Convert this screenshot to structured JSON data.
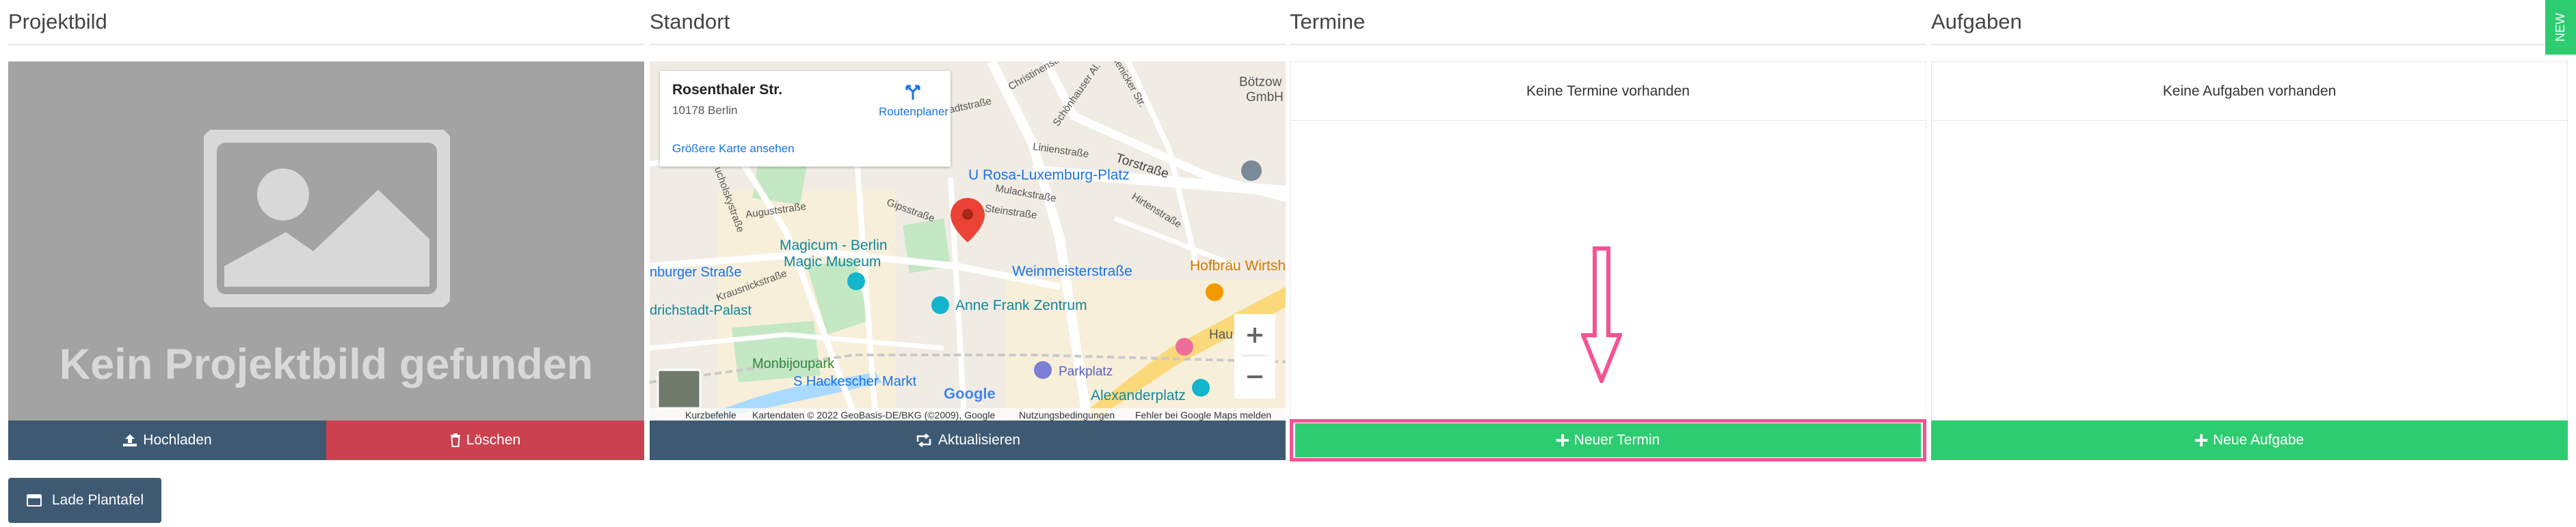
{
  "projektbild": {
    "title": "Projektbild",
    "placeholder_text": "Kein Projektbild gefunden",
    "upload_label": "Hochladen",
    "delete_label": "Löschen"
  },
  "standort": {
    "title": "Standort",
    "address_line1": "Rosenthaler Str.",
    "address_line2": "10178 Berlin",
    "route_label": "Routenplaner",
    "larger_map_link": "Größere Karte ansehen",
    "refresh_label": "Aktualisieren",
    "map_footer": {
      "shortcuts": "Kurzbefehle",
      "data": "Kartendaten © 2022 GeoBasis-DE/BKG (©2009), Google",
      "terms": "Nutzungsbedingungen",
      "report": "Fehler bei Google Maps melden"
    },
    "map_places": [
      "U Rosa-Luxemburg-Platz",
      "Torstraße",
      "Magicum - Berlin",
      "Magic Museum",
      "Weinmeisterstraße",
      "Hofbräu Wirtsh",
      "Anne Frank Zentrum",
      "Monbijoupark",
      "S Hackescher Markt",
      "Parkplatz",
      "Alexanderplatz",
      "Bötzow",
      "GmbH",
      "nburger Straße",
      "drichstadt-Palast",
      "Hau",
      "Google"
    ],
    "map_streets": [
      "Schönhauser Al.",
      "Linienstraße",
      "Mulackstraße",
      "Steinstraße",
      "Gipsstraße",
      "Auguststraße",
      "Tucholskystraße",
      "Krausnickstraße",
      "Hirtenstraße",
      "Almstadtstraße",
      "Christinenstr.",
      "Zehdenicker Str.",
      "Linienstraße"
    ]
  },
  "termine": {
    "title": "Termine",
    "empty_text": "Keine Termine vorhanden",
    "new_label": "Neuer Termin"
  },
  "aufgaben": {
    "title": "Aufgaben",
    "empty_text": "Keine Aufgaben vorhanden",
    "new_label": "Neue Aufgabe"
  },
  "bottom": {
    "plantafel_label": "Lade Plantafel"
  },
  "side_tab": {
    "label": "NEW"
  },
  "colors": {
    "dark_blue": "#3e5a73",
    "red": "#cb414f",
    "green": "#2ecc71",
    "highlight_pink": "#f45394"
  }
}
